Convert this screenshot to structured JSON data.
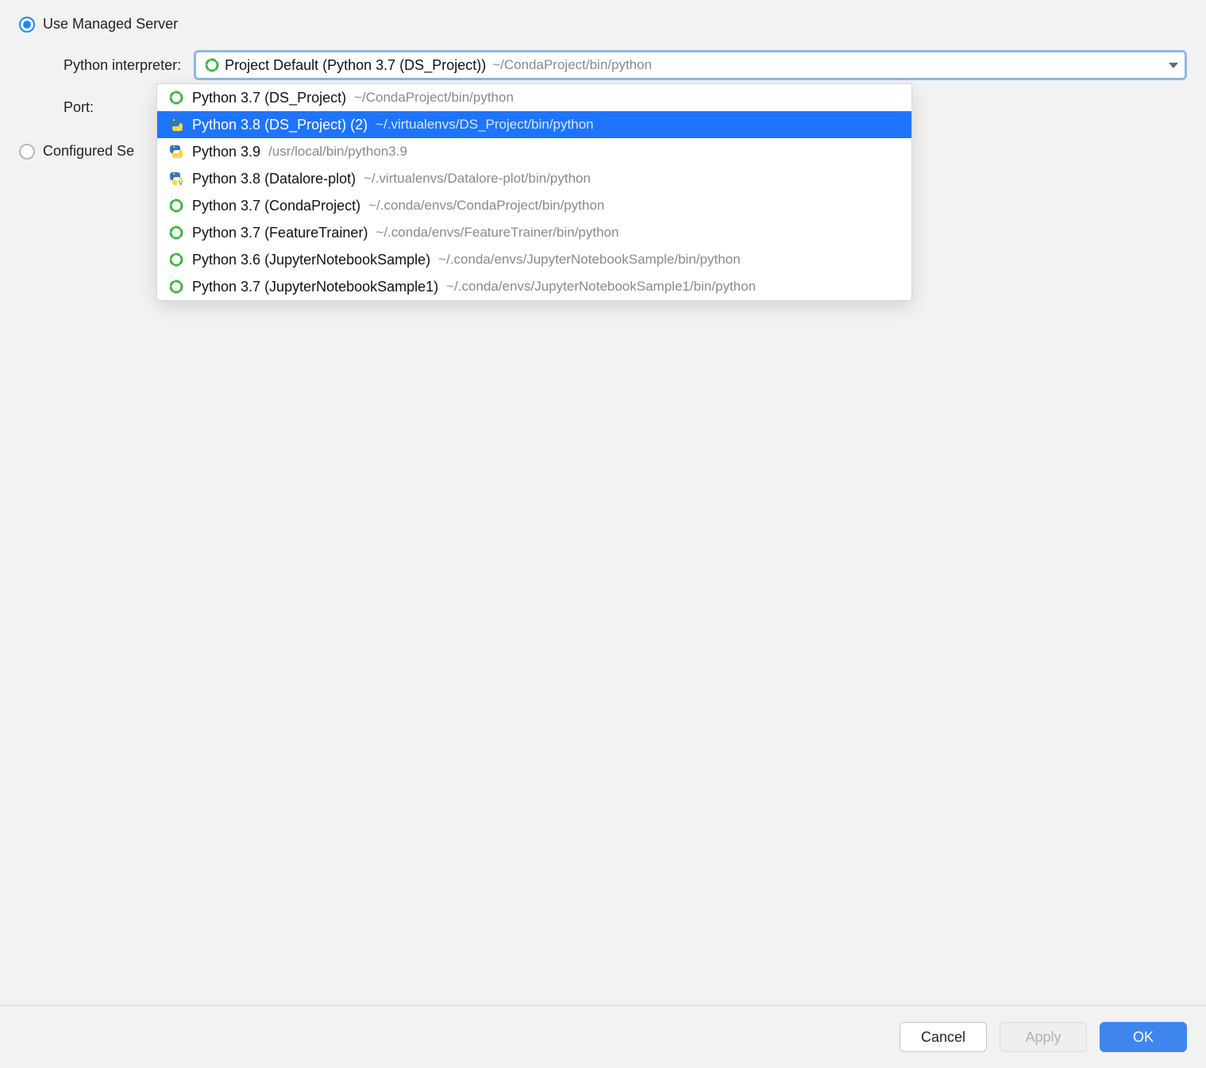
{
  "radios": {
    "managed_label": "Use Managed Server",
    "configured_label_visible": "Configured Se"
  },
  "fields": {
    "interpreter_label": "Python interpreter:",
    "port_label": "Port:"
  },
  "combo": {
    "selected_name": "Project Default (Python 3.7 (DS_Project))",
    "selected_path": "~/CondaProject/bin/python",
    "icon": "conda-ring"
  },
  "dropdown": {
    "selected_index": 1,
    "items": [
      {
        "icon": "conda-ring",
        "name": "Python 3.7 (DS_Project)",
        "path": "~/CondaProject/bin/python"
      },
      {
        "icon": "python",
        "name": "Python 3.8 (DS_Project) (2)",
        "path": "~/.virtualenvs/DS_Project/bin/python"
      },
      {
        "icon": "python",
        "name": "Python 3.9",
        "path": "/usr/local/bin/python3.9"
      },
      {
        "icon": "python-v",
        "name": "Python 3.8 (Datalore-plot)",
        "path": "~/.virtualenvs/Datalore-plot/bin/python"
      },
      {
        "icon": "conda-ring",
        "name": "Python 3.7 (CondaProject)",
        "path": "~/.conda/envs/CondaProject/bin/python"
      },
      {
        "icon": "conda-ring",
        "name": "Python 3.7 (FeatureTrainer)",
        "path": "~/.conda/envs/FeatureTrainer/bin/python"
      },
      {
        "icon": "conda-ring",
        "name": "Python 3.6 (JupyterNotebookSample)",
        "path": "~/.conda/envs/JupyterNotebookSample/bin/python"
      },
      {
        "icon": "conda-ring",
        "name": "Python 3.7 (JupyterNotebookSample1)",
        "path": "~/.conda/envs/JupyterNotebookSample1/bin/python"
      }
    ]
  },
  "buttons": {
    "cancel": "Cancel",
    "apply": "Apply",
    "ok": "OK"
  },
  "icons": {
    "conda-ring": "conda-ring-icon",
    "python": "python-icon",
    "python-v": "python-virtualenv-icon",
    "caret": "chevron-down-icon"
  }
}
